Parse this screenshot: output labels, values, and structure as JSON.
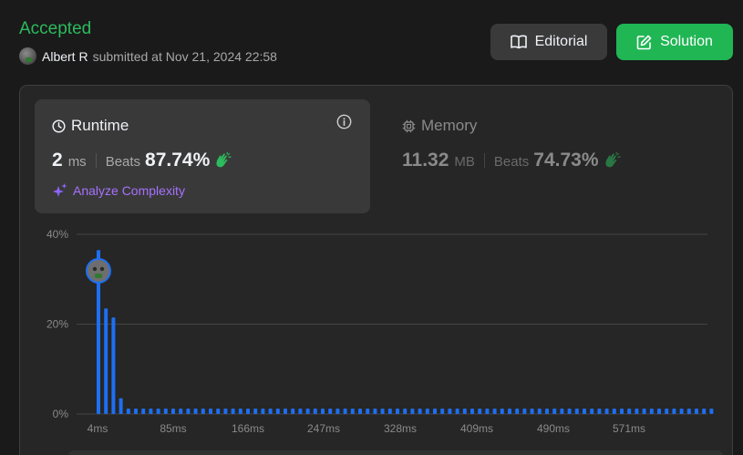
{
  "status": "Accepted",
  "submission": {
    "user": "Albert R",
    "text": "submitted at Nov 21, 2024 22:58"
  },
  "buttons": {
    "editorial": "Editorial",
    "solution": "Solution"
  },
  "runtime": {
    "title": "Runtime",
    "value": "2",
    "unit": "ms",
    "beats_label": "Beats",
    "beats": "87.74%",
    "analyze": "Analyze Complexity"
  },
  "memory": {
    "title": "Memory",
    "value": "11.32",
    "unit": "MB",
    "beats_label": "Beats",
    "beats": "74.73%"
  },
  "colors": {
    "accepted": "#2cbb5d",
    "solution_btn": "#20b654",
    "bar": "#1d6ff2",
    "analyze": "#a772ff",
    "clap": "#2cbb5d"
  },
  "icons": [
    "book-icon",
    "edit-icon",
    "clock-icon",
    "info-icon",
    "chip-icon",
    "sparkle-icon",
    "clap-icon"
  ],
  "chart_data": {
    "type": "bar",
    "x_ticks": [
      "4ms",
      "85ms",
      "166ms",
      "247ms",
      "328ms",
      "409ms",
      "490ms",
      "571ms"
    ],
    "y_ticks": [
      "40%",
      "20%",
      "0%"
    ],
    "ylim": [
      0,
      40
    ],
    "grid": true,
    "highlighted_index": 0,
    "values": [
      36.5,
      23.5,
      21.5,
      3.5,
      1.2,
      1.2,
      1.2,
      1.2,
      1.2,
      1.2,
      1.2,
      1.2,
      1.2,
      1.2,
      1.2,
      1.2,
      1.2,
      1.2,
      1.2,
      1.2,
      1.2,
      1.2,
      1.2,
      1.2,
      1.2,
      1.2,
      1.2,
      1.2,
      1.2,
      1.2,
      1.2,
      1.2,
      1.2,
      1.2,
      1.2,
      1.2,
      1.2,
      1.2,
      1.2,
      1.2,
      1.2,
      1.2,
      1.2,
      1.2,
      1.2,
      1.2,
      1.2,
      1.2,
      1.2,
      1.2,
      1.2,
      1.2,
      1.2,
      1.2,
      1.2,
      1.2,
      1.2,
      1.2,
      1.2,
      1.2,
      1.2,
      1.2,
      1.2,
      1.2,
      1.2,
      1.2,
      1.2,
      1.2,
      1.2,
      1.2,
      1.2,
      1.2,
      1.2,
      1.2,
      1.2,
      1.2,
      1.2,
      1.2,
      1.2,
      1.2,
      1.2,
      1.2,
      1.2
    ]
  }
}
